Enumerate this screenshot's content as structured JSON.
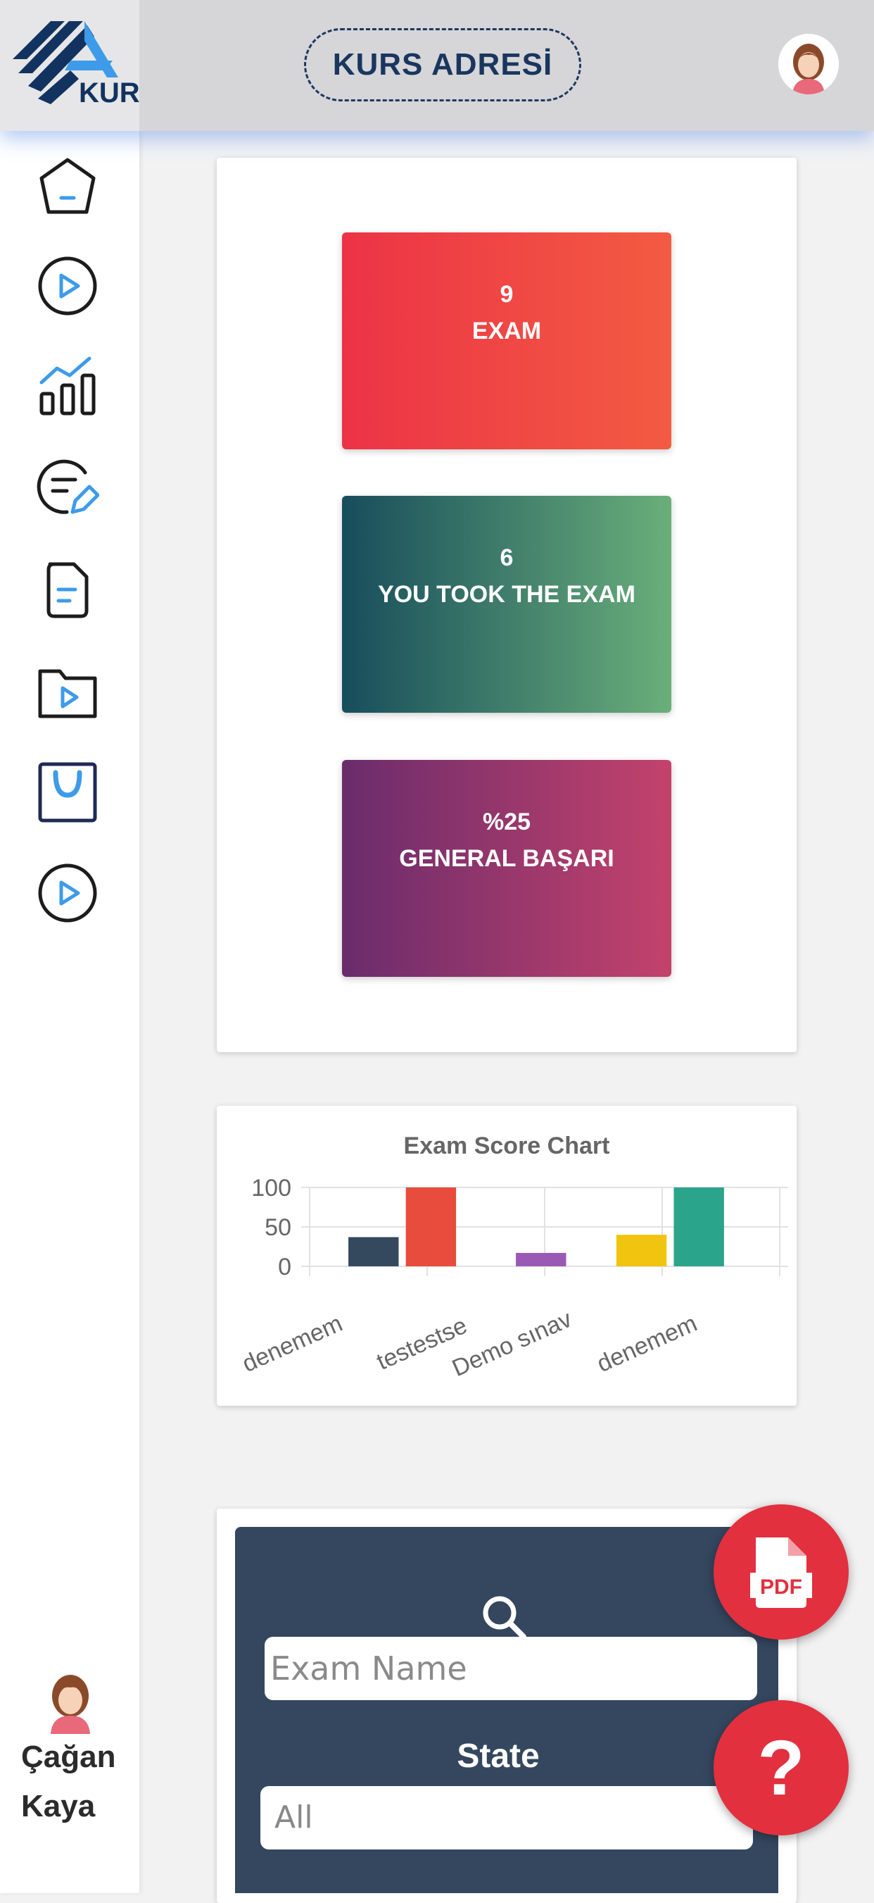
{
  "header": {
    "logo_text": "KUR",
    "course_address": "KURS ADRESİ"
  },
  "stats": [
    {
      "value": "9",
      "label": "EXAM"
    },
    {
      "value": "6",
      "label": "YOU TOOK THE EXAM"
    },
    {
      "value": "%25",
      "label": "GENERAL BAŞARI"
    }
  ],
  "chart_data": {
    "type": "bar",
    "title": "Exam Score Chart",
    "categories": [
      "denemem",
      "testestse",
      "Demo  sınav",
      "denemem"
    ],
    "series_values": [
      {
        "category": "denemem",
        "value": 37,
        "color": "#34495e"
      },
      {
        "category": "denemem",
        "value": 100,
        "color": "#e74c3c"
      },
      {
        "category": "Demo  sınav",
        "value": 17,
        "color": "#9b59b6"
      },
      {
        "category": "denemem",
        "value": 40,
        "color": "#f1c40f"
      },
      {
        "category": "denemem",
        "value": 100,
        "color": "#2aa58b"
      }
    ],
    "yticks": [
      "100",
      "50",
      "0"
    ],
    "ylim": [
      0,
      100
    ],
    "grid": true
  },
  "filter": {
    "exam_name_placeholder": "Exam Name",
    "state_label": "State",
    "state_value": "All"
  },
  "fab": {
    "help_symbol": "?"
  },
  "user": {
    "first_name": "Çağan",
    "last_name": "Kaya"
  },
  "colors": {
    "brand_navy": "#12335f",
    "brand_blue": "#3d9be9",
    "filter_bg": "#34475f",
    "fab_red": "#e2303f"
  },
  "sidebar_icons": [
    "home-icon",
    "play-icon",
    "stats-chart-icon",
    "edit-note-icon",
    "document-icon",
    "video-folder-icon",
    "shopping-bag-icon",
    "play-icon"
  ]
}
